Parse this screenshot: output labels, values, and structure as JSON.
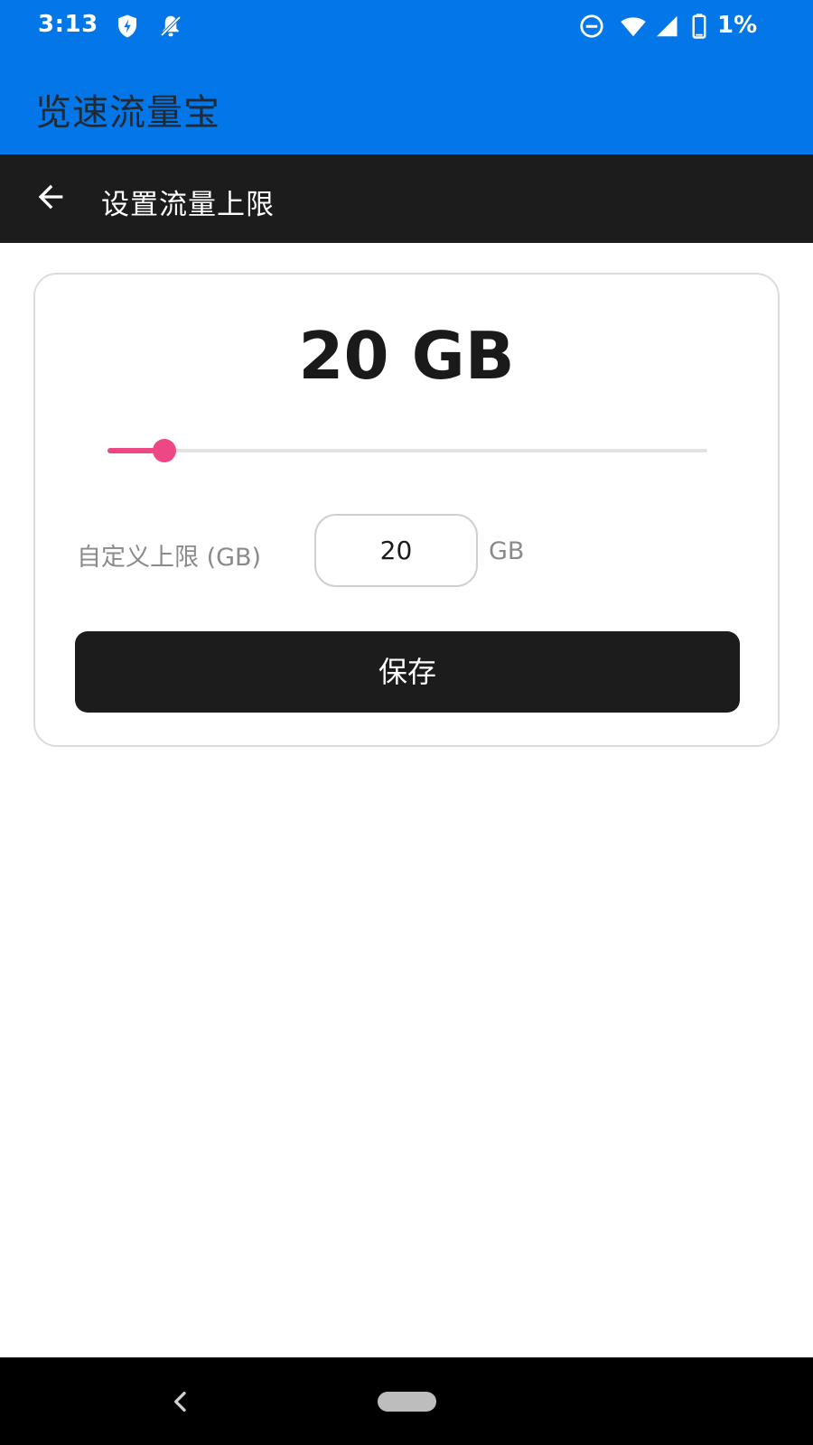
{
  "status_bar": {
    "time": "3:13",
    "battery_text": "1%",
    "icons": [
      "shield-icon",
      "notifications-off-icon",
      "do-not-disturb-icon",
      "wifi-icon",
      "cell-signal-icon",
      "battery-icon"
    ]
  },
  "app_bar": {
    "title": "览速流量宝",
    "color": "#0377E8"
  },
  "sub_header": {
    "title": "设置流量上限",
    "back_icon": "arrow-left-icon"
  },
  "limit": {
    "display": "20 GB",
    "slider_fraction": 0.095,
    "slider_color": "#EE4785",
    "custom_label": "自定义上限 (GB)",
    "input_value": "20",
    "unit": "GB",
    "save_label": "保存"
  },
  "nav_bar": {
    "icons": [
      "nav-back-icon",
      "nav-home-pill"
    ]
  }
}
